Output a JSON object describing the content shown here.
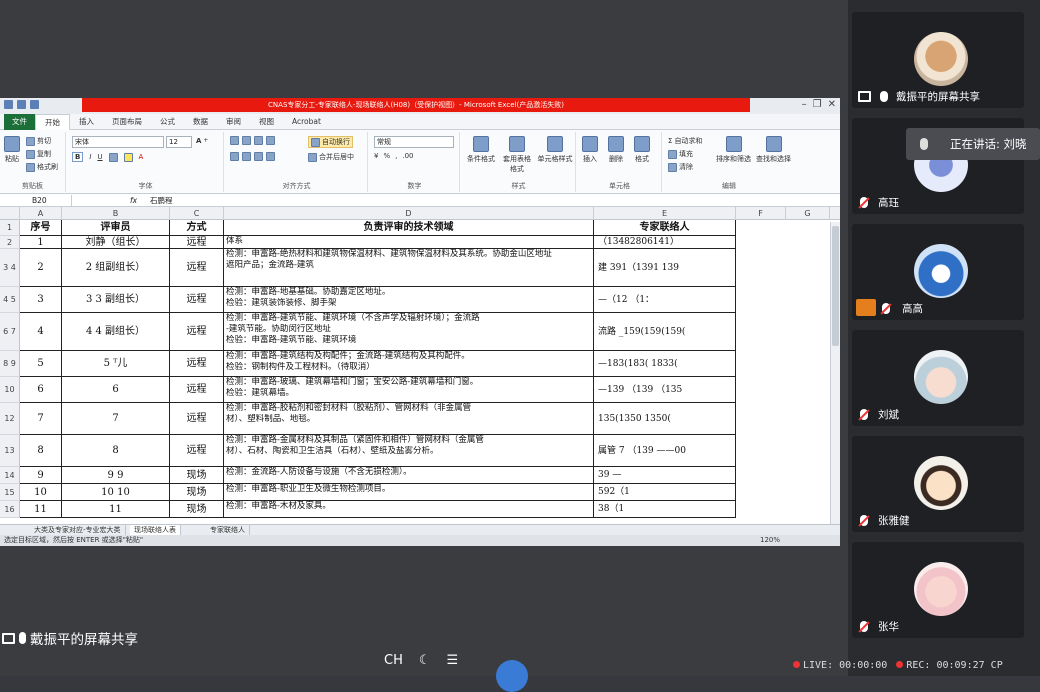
{
  "excel": {
    "title": "CNAS专家分工-专家联络人-现场联络人(H08)（受保护视图）- Microsoft Excel(产品激活失败)",
    "tabs": [
      "文件",
      "开始",
      "插入",
      "页面布局",
      "公式",
      "数据",
      "审阅",
      "视图",
      "Acrobat"
    ],
    "ribbon": {
      "clipboard": {
        "cut": "剪切",
        "copy": "复制",
        "painter": "格式刷",
        "paste": "粘贴",
        "label": "剪贴板"
      },
      "font": {
        "name": "宋体",
        "size": "12",
        "label": "字体"
      },
      "align": {
        "wrap": "自动换行",
        "merge": "合并后居中",
        "label": "对齐方式"
      },
      "number": {
        "format": "常规",
        "label": "数字"
      },
      "styles": {
        "cond": "条件格式",
        "table": "套用表格格式",
        "cell": "单元格样式",
        "label": "样式"
      },
      "cells": {
        "insert": "插入",
        "delete": "删除",
        "format": "格式",
        "label": "单元格"
      },
      "edit": {
        "autosum": "自动求和",
        "fill": "填充",
        "clear": "清除",
        "sort": "排序和筛选",
        "find": "查找和选择",
        "label": "编辑"
      }
    },
    "namebox": "B20",
    "fx": "fx",
    "formula_value": "石鹏程",
    "columns": [
      "A",
      "B",
      "C",
      "D",
      "E",
      "F",
      "G"
    ],
    "header_row": {
      "num": "序号",
      "reviewer": "评审员",
      "mode": "方式",
      "domain": "负责评审的技术领域",
      "contact": "专家联络人"
    },
    "rows": [
      {
        "rn": "2",
        "a": "1",
        "b": "刘静（组长）",
        "c": "远程",
        "d": [
          "体系"
        ],
        "e": "（13482806141）"
      },
      {
        "rn": "3 4",
        "a": "2",
        "b": "2 组副组长）",
        "c": "远程",
        "d": [
          "检测：申富路-绝热材料和建筑物保温材料、建筑物保温材料及其系统。协助金山区地址",
          "遮阳产品；金流路-建筑"
        ],
        "e": "建  391（1391 139"
      },
      {
        "rn": "4 5",
        "a": "3",
        "b": "3    3      副组长）",
        "c": "远程",
        "d": [
          "检测：申富路-地基基础。协助嘉定区地址。",
          "检验：建筑装饰装修、脚手架"
        ],
        "e": "—（12    （1："
      },
      {
        "rn": "6 7",
        "a": "4",
        "b": "4    4      副组长）",
        "c": "远程",
        "d": [
          "检测：申富路-建筑节能、建筑环境（不含声学及辐射环境）；金流路",
          "-建筑节能。协助闵行区地址",
          "检验：申富路-建筑节能、建筑环境"
        ],
        "e": "流路 _159(159(159("
      },
      {
        "rn": "8 9",
        "a": "5",
        "b": "5    ᵀ儿",
        "c": "远程",
        "d": [
          "检测：申富路-建筑结构及构配件；金流路-建筑结构及其构配件。",
          "检验：钢制构件及工程材料。（待取消）"
        ],
        "e": "—183(183( 1833("
      },
      {
        "rn": "10 11",
        "a": "6",
        "b": "6",
        "c": "远程",
        "d": [
          "检测：申富路-玻璃、建筑幕墙和门窗；宝安公路-建筑幕墙和门窗。",
          "检验：建筑幕墙。"
        ],
        "e": "—139   （139    （135"
      },
      {
        "rn": "12",
        "a": "7",
        "b": "7",
        "c": "远程",
        "d": [
          "检测：申富路-胶粘剂和密封材料（胶粘剂）、管网材料（非金属管",
          "材）、塑料制品、地毯。"
        ],
        "e": "135(1350 1350("
      },
      {
        "rn": "13",
        "a": "8",
        "b": "8",
        "c": "远程",
        "d": [
          "检测：申富路-金属材料及其制品（紧固件和相件）管网材料（金属管",
          "材）、石材、陶瓷和卫生洁具（石材）、壁纸及盐雾分析。"
        ],
        "e": "属管 7   （139   ——00"
      },
      {
        "rn": "14",
        "a": "9",
        "b": "9        9",
        "c": "现场",
        "d": [
          "检测：金流路-人防设备与设施（不含无损检测）。"
        ],
        "e": "39    —"
      },
      {
        "rn": "15",
        "a": "10",
        "b": "10      10",
        "c": "现场",
        "d": [
          "检测：申富路-职业卫生及微生物检测项目。"
        ],
        "e": "592（1"
      },
      {
        "rn": "16",
        "a": "11",
        "b": "11",
        "c": "现场",
        "d": [
          "检测：申富路-木材及家具。"
        ],
        "e": "38（1"
      }
    ],
    "sheet_tabs": [
      "大类及专家对应-专业宏大类",
      "现场联络人表",
      "专家联络人"
    ],
    "status": "选定目标区域，然后按 ENTER 或选择\"粘贴\"",
    "zoom": "120%"
  },
  "share": {
    "label": "戴振平的屏幕共享"
  },
  "taskbar": {
    "ime": "CH"
  },
  "participants": [
    {
      "name": "戴振平的屏幕共享",
      "avatar": "dog"
    },
    {
      "name": "高珏",
      "avatar": "blank"
    },
    {
      "name": "高高",
      "avatar": "penguin"
    },
    {
      "name": "刘斌",
      "avatar": "anime"
    },
    {
      "name": "张雅健",
      "avatar": "cartoon"
    },
    {
      "name": "张华",
      "avatar": "baby"
    }
  ],
  "speaking": "正在讲话: 刘晓",
  "recording": {
    "live_label": "LIVE:",
    "live_time": "00:00:00",
    "rec_label": "REC:",
    "rec_time": "00:09:27",
    "extra": "CP"
  }
}
